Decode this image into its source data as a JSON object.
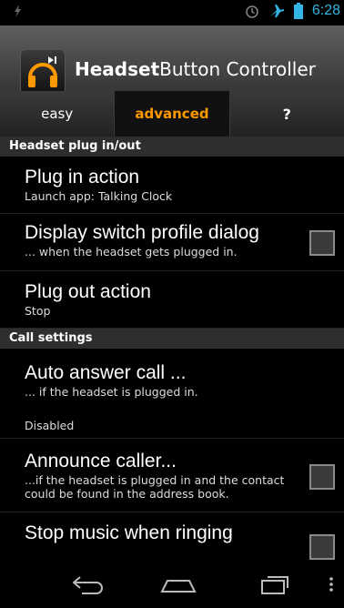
{
  "status_bar": {
    "time": "6:28",
    "icons": [
      "alarm-icon",
      "airplane-icon",
      "battery-icon"
    ]
  },
  "app": {
    "title_bold": "Headset",
    "title_rest": "Button Controller"
  },
  "tabs": [
    {
      "label": "easy",
      "active": false
    },
    {
      "label": "advanced",
      "active": true
    },
    {
      "label": "?",
      "active": false
    }
  ],
  "sections": {
    "plug": "Headset plug in/out",
    "call": "Call settings"
  },
  "items": {
    "plug_in": {
      "title": "Plug in action",
      "summary": "Launch app: Talking Clock"
    },
    "display_switch": {
      "title": "Display switch profile dialog",
      "summary": "... when the headset gets plugged in.",
      "checked": false
    },
    "plug_out": {
      "title": "Plug out action",
      "summary": "Stop"
    },
    "auto_answer": {
      "title": "Auto answer call ...",
      "summary": "... if the headset is plugged in.",
      "value": "Disabled"
    },
    "announce": {
      "title": "Announce caller...",
      "summary_line1": "...if the headset is plugged in and the contact",
      "summary_line2": "could be found in the address book.",
      "checked": false
    },
    "stop_music": {
      "title": "Stop music when ringing",
      "checked": false
    }
  },
  "colors": {
    "accent": "#ff9900",
    "clock": "#33b5e5"
  }
}
